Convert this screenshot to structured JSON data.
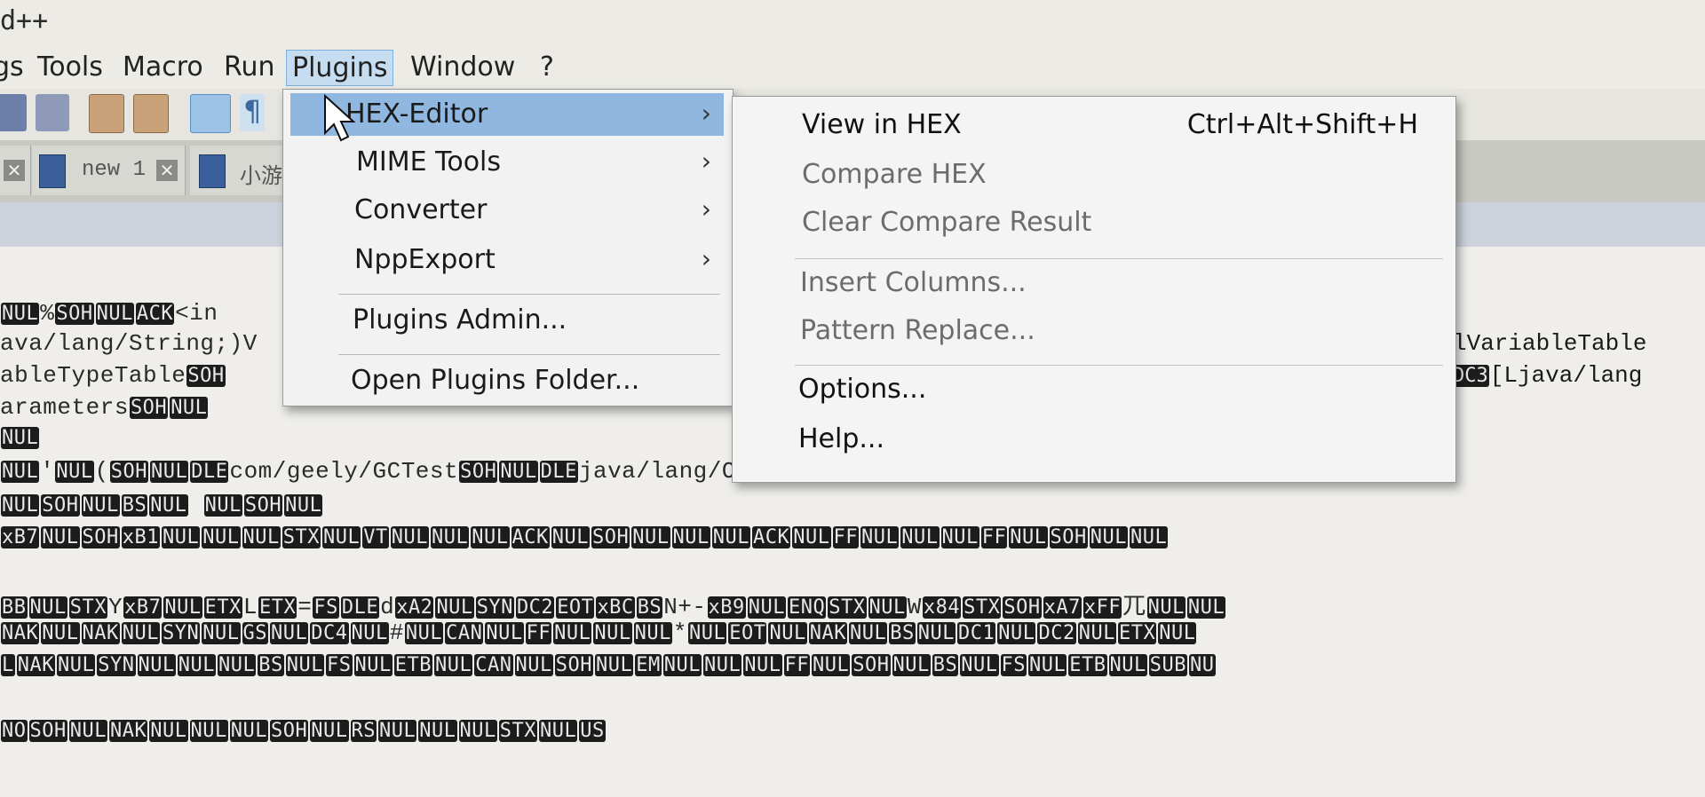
{
  "window": {
    "title_fragment": "d++"
  },
  "menubar": {
    "items": [
      "gs",
      "Tools",
      "Macro",
      "Run",
      "Plugins",
      "Window",
      "?"
    ]
  },
  "tabs": [
    {
      "label": "new 1"
    },
    {
      "label": "小游"
    }
  ],
  "plugins_menu": {
    "items": [
      {
        "label": "HEX-Editor",
        "submenu": true,
        "highlighted": true
      },
      {
        "label": "MIME Tools",
        "submenu": true
      },
      {
        "label": "Converter",
        "submenu": true
      },
      {
        "label": "NppExport",
        "submenu": true
      },
      {
        "label": "Plugins Admin..."
      },
      {
        "label": "Open Plugins Folder..."
      }
    ],
    "arrow": "›"
  },
  "hex_submenu": {
    "items": [
      {
        "label": "View in HEX",
        "shortcut": "Ctrl+Alt+Shift+H",
        "enabled": true
      },
      {
        "label": "Compare HEX",
        "enabled": false
      },
      {
        "label": "Clear Compare Result",
        "enabled": false
      },
      {
        "label": "Insert Columns...",
        "enabled": false
      },
      {
        "label": "Pattern Replace...",
        "enabled": false
      },
      {
        "label": "Options...",
        "enabled": true
      },
      {
        "label": "Help...",
        "enabled": true
      }
    ]
  },
  "editor": {
    "right_fragments": {
      "line2": "lVariableTable",
      "line3_cc": "DC3",
      "line3": "[Ljava/lang"
    }
  },
  "colors": {
    "menu_highlight": "#8fb7e0",
    "control_char_bg": "#1c1c1c",
    "editor_bg": "#efeeea"
  }
}
